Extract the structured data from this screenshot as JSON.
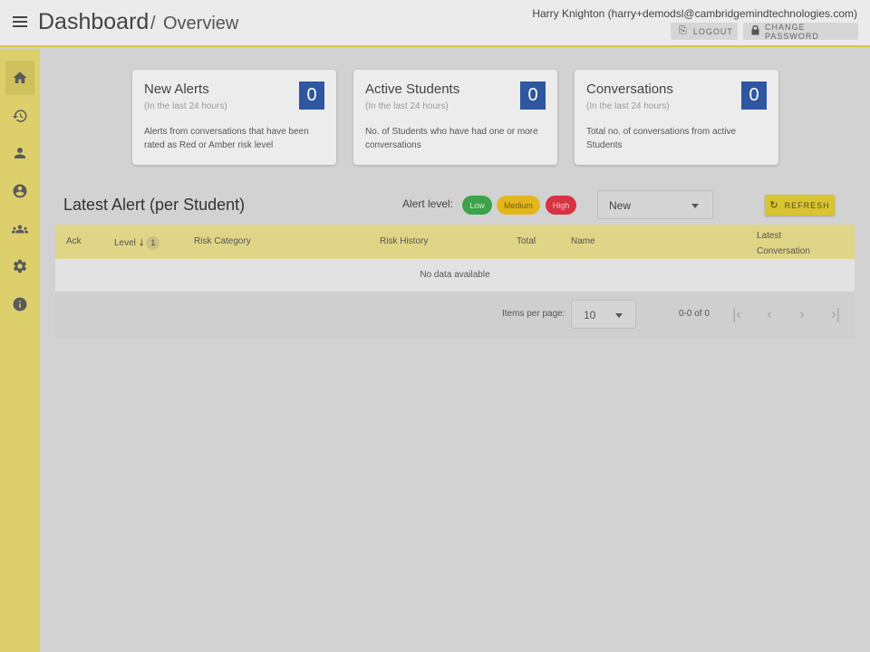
{
  "header": {
    "breadcrumb_main": "Dashboard",
    "breadcrumb_separator": "/",
    "breadcrumb_current": "Overview",
    "user": "Harry Knighton (harry+demodsl@cambridgemindtechnologies.com)",
    "logout_label": "LOGOUT",
    "change_password_label": "CHANGE PASSWORD"
  },
  "sidebar": {
    "items": [
      {
        "icon": "home-icon",
        "active": true
      },
      {
        "icon": "history-icon"
      },
      {
        "icon": "person-icon"
      },
      {
        "icon": "account-circle-icon"
      },
      {
        "icon": "group-icon"
      },
      {
        "icon": "gear-icon"
      },
      {
        "icon": "info-icon"
      }
    ]
  },
  "cards": [
    {
      "title": "New Alerts",
      "subtitle": "(In the last 24 hours)",
      "count": "0",
      "description": "Alerts from conversations that have been rated as Red or Amber risk level"
    },
    {
      "title": "Active Students",
      "subtitle": "(In the last 24 hours)",
      "count": "0",
      "description": "No. of Students who have had one or more conversations"
    },
    {
      "title": "Conversations",
      "subtitle": "(In the last 24 hours)",
      "count": "0",
      "description": "Total no. of conversations from active Students"
    }
  ],
  "alerts": {
    "title": "Latest Alert (per Student)",
    "level_label": "Alert level:",
    "levels": [
      {
        "label": "Low",
        "color": "#3ca34a"
      },
      {
        "label": "Medium",
        "color": "#e3b61e"
      },
      {
        "label": "High",
        "color": "#d63343"
      }
    ],
    "status_filter": "New",
    "refresh_label": "REFRESH"
  },
  "table": {
    "columns": {
      "ack": "Ack",
      "level": "Level",
      "level_sort_order": "1",
      "risk_category": "Risk Category",
      "risk_history": "Risk History",
      "total": "Total",
      "name": "Name",
      "latest_conversation": "Latest Conversation"
    },
    "empty_message": "No data available",
    "items_per_page_label": "Items per page:",
    "items_per_page": "10",
    "range": "0-0 of 0"
  },
  "colors": {
    "accent": "#ddd06c",
    "count_badge": "#2f56a0",
    "refresh": "#d9c432"
  }
}
